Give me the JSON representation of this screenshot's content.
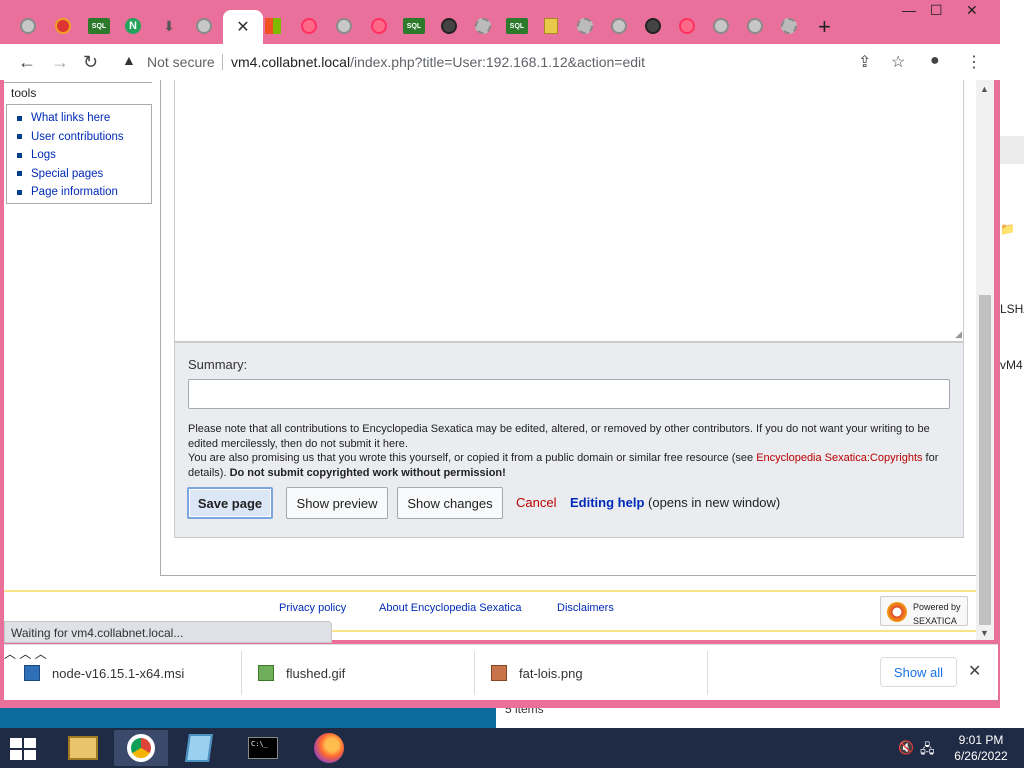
{
  "browser": {
    "active_tab_close": "✕",
    "new_tab": "+",
    "window_controls": {
      "minimize": "—",
      "maximize": "☐",
      "close": "✕"
    },
    "security": "Not secure",
    "url_host": "vm4.collabnet.local",
    "url_path": "/index.php?title=User:192.168.1.12&action=edit",
    "tab_sql_label": "SQL\nite"
  },
  "sidebar": {
    "heading": "tools",
    "items": [
      {
        "label": "What links here"
      },
      {
        "label": "User contributions"
      },
      {
        "label": "Logs"
      },
      {
        "label": "Special pages"
      },
      {
        "label": "Page information"
      }
    ]
  },
  "editor": {
    "summary_label": "Summary:",
    "summary_value": "",
    "notice_line1": "Please note that all contributions to Encyclopedia Sexatica may be edited, altered, or removed by other contributors. If you do not want your writing to be edited mercilessly, then do not submit it here.",
    "notice_line2_prefix": "You are also promising us that you wrote this yourself, or copied it from a public domain or similar free resource (see ",
    "notice_link": "Encyclopedia Sexatica:Copyrights",
    "notice_line2_suffix": " for details). ",
    "notice_strong": "Do not submit copyrighted work without permission!",
    "buttons": {
      "save": "Save page",
      "preview": "Show preview",
      "changes": "Show changes",
      "cancel": "Cancel",
      "help": "Editing help",
      "help_note": "(opens in new window)"
    }
  },
  "footer": {
    "links": [
      "Privacy policy",
      "About Encyclopedia Sexatica",
      "Disclaimers"
    ],
    "powered_line1": "Powered by",
    "powered_line2": "SEXATICA"
  },
  "status": "Waiting for vm4.collabnet.local...",
  "downloads": {
    "items": [
      {
        "name": "node-v16.15.1-x64.msi"
      },
      {
        "name": "flushed.gif"
      },
      {
        "name": "fat-lois.png"
      }
    ],
    "show_all": "Show all"
  },
  "background_window": {
    "text_a": "LSHA",
    "text_b": "vM4",
    "text_c": "5 items"
  },
  "taskbar": {
    "time": "9:01 PM",
    "date": "6/26/2022"
  },
  "colors": {
    "chrome_frame": "#e8709a",
    "link": "#002bb8",
    "new_link": "#ba0000",
    "taskbar": "#1f2a44"
  }
}
